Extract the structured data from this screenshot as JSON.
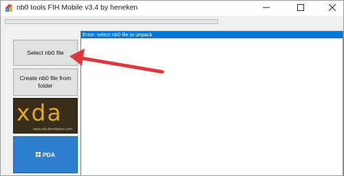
{
  "window": {
    "title": "nb0 tools FIH Mobile v3.4 by heneken"
  },
  "controls": {
    "minimize_icon": "minimize-icon",
    "maximize_icon": "maximize-icon",
    "close_icon": "close-icon"
  },
  "buttons": {
    "select_label": "Select nb0 file",
    "create_label": "Create nb0 file from\nfolder"
  },
  "banners": {
    "xda_logo": "xda",
    "xda_url": "www.xda-developers.com",
    "pda_text": "PDA"
  },
  "log": {
    "lines": [
      "Error: select nb0 file to unpack"
    ]
  },
  "colors": {
    "selection": "#0078d7",
    "arrow": "#e0373a",
    "xda_bg": "#3a2e1a",
    "xda_gold": "#e2a81e",
    "pda_bg": "#2f7fd1"
  }
}
